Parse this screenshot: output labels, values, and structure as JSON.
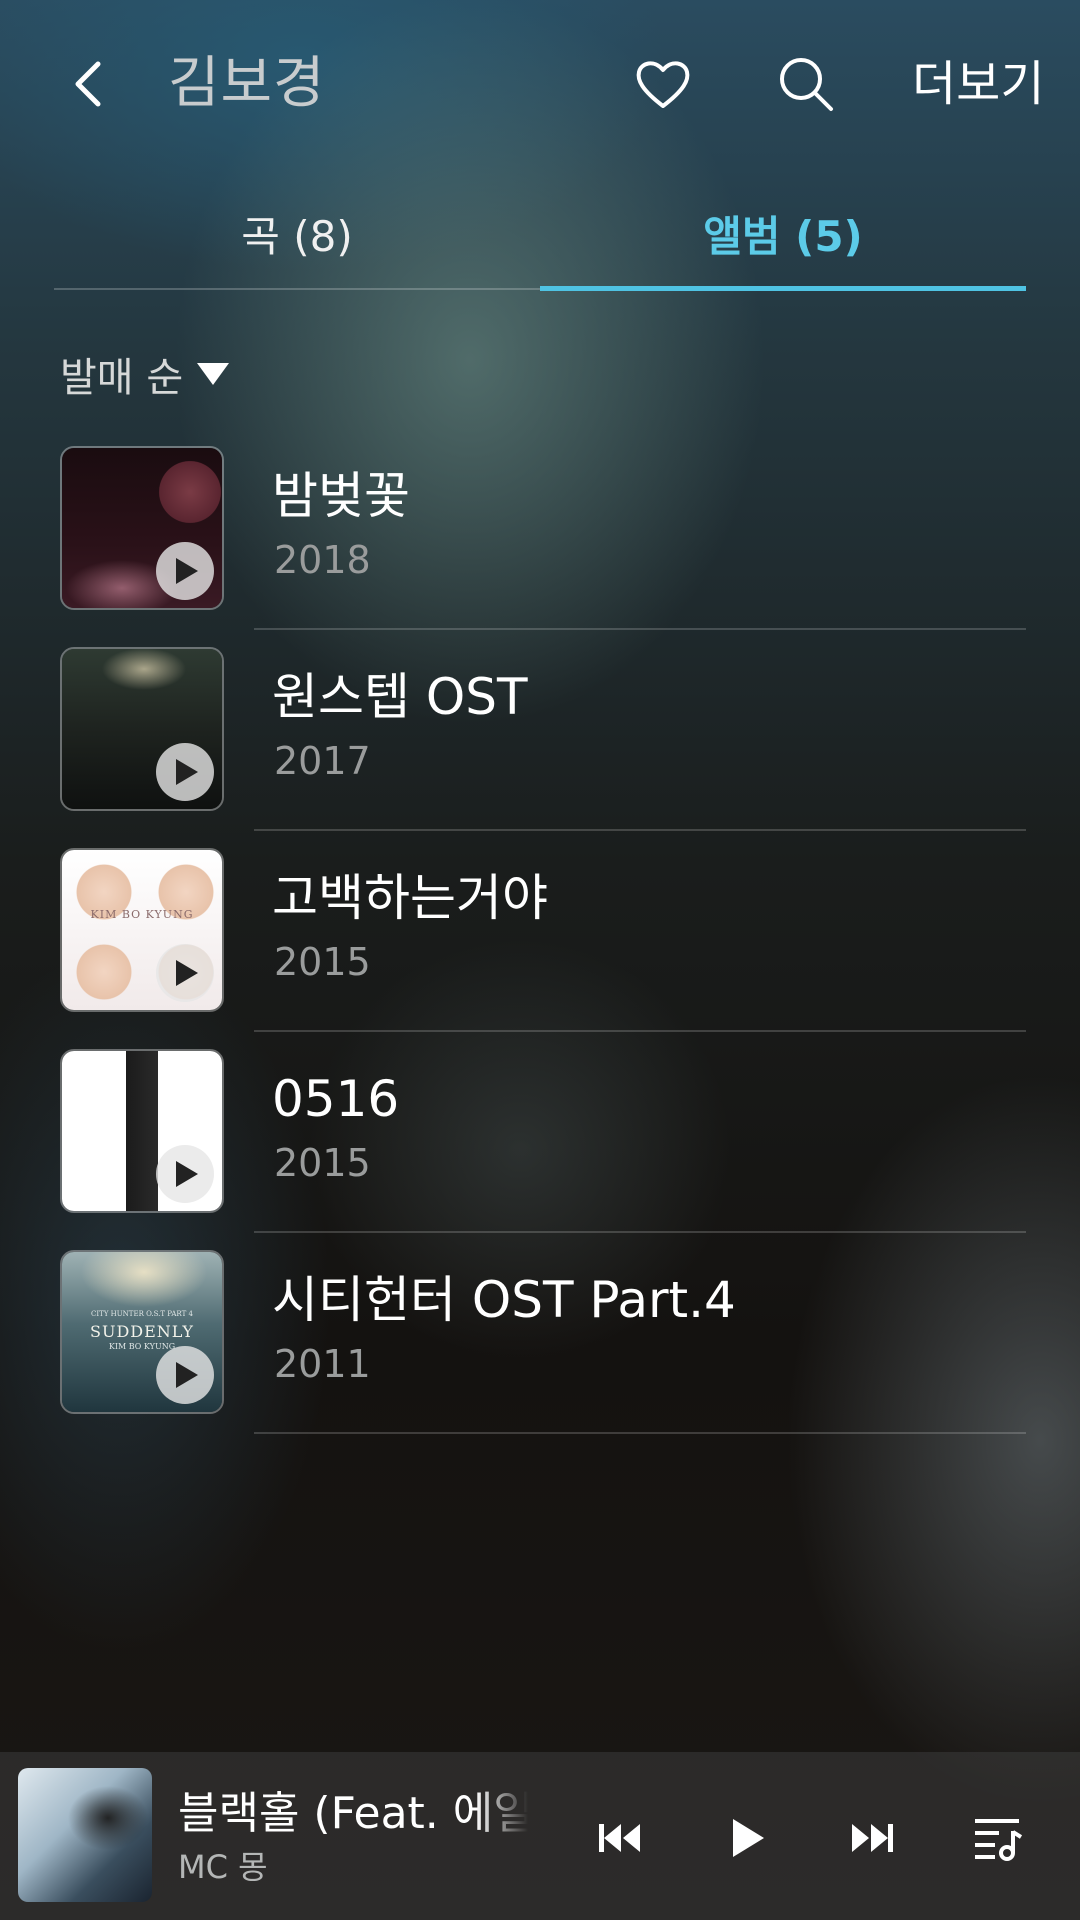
{
  "header": {
    "title": "김보경",
    "more_label": "더보기"
  },
  "tabs": [
    {
      "label": "곡 (8)",
      "active": false
    },
    {
      "label": "앨범 (5)",
      "active": true
    }
  ],
  "sort": {
    "label": "발매 순"
  },
  "albums": [
    {
      "title": "밤벚꽃",
      "year": "2018"
    },
    {
      "title": "원스텝 OST",
      "year": "2017"
    },
    {
      "title": "고백하는거야",
      "year": "2015"
    },
    {
      "title": "0516",
      "year": "2015"
    },
    {
      "title": "시티헌터 OST Part.4",
      "year": "2011"
    }
  ],
  "cover_texts": {
    "album_3": "KIM BO KYUNG",
    "album_5_top": "CITY HUNTER O.S.T PART 4",
    "album_5_main": "SUDDENLY",
    "album_5_sub": "KIM BO KYUNG"
  },
  "now_playing": {
    "song": "블랙홀 (Feat. 에일리)",
    "artist": "MC 몽"
  },
  "colors": {
    "accent": "#4fc3e3",
    "text_primary": "#ffffff",
    "text_secondary": "#9a9c9c"
  },
  "icons": [
    "back-arrow-icon",
    "heart-icon",
    "search-icon",
    "sort-arrow-icon",
    "play-icon",
    "previous-icon",
    "next-icon",
    "queue-icon"
  ]
}
